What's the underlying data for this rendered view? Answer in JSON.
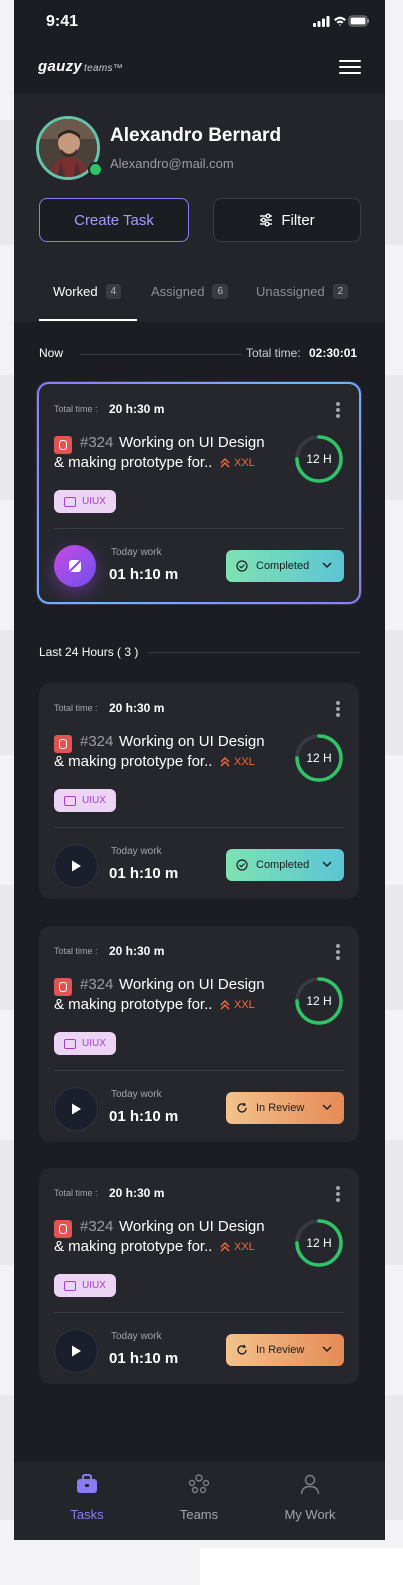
{
  "status_bar": {
    "time": "9:41"
  },
  "header": {
    "brand": "gauzy",
    "brand_suffix": "teams™"
  },
  "profile": {
    "name": "Alexandro Bernard",
    "email": "Alexandro@mail.com"
  },
  "actions": {
    "create_task": "Create Task",
    "filter": "Filter"
  },
  "tabs": [
    {
      "label": "Worked",
      "count": "4",
      "active": true
    },
    {
      "label": "Assigned",
      "count": "6",
      "active": false
    },
    {
      "label": "Unassigned",
      "count": "2",
      "active": false
    }
  ],
  "now_section": {
    "label": "Now",
    "total_label": "Total time:",
    "total_value": "02:30:01"
  },
  "last24_section": {
    "label": "Last 24 Hours ( 3 )"
  },
  "cards": [
    {
      "total_label": "Total time :",
      "total_value": "20 h:30 m",
      "task_number": "#324",
      "title_line1": "Working on UI Design",
      "title_line2": "& making prototype for..",
      "priority": "XXL",
      "estimate": "12 H",
      "progress": 0.75,
      "tag": "UIUX",
      "today_label": "Today work",
      "today_value": "01 h:10 m",
      "status": "Completed",
      "status_type": "completed"
    },
    {
      "total_label": "Total time :",
      "total_value": "20 h:30 m",
      "task_number": "#324",
      "title_line1": "Working on UI Design",
      "title_line2": "& making prototype for..",
      "priority": "XXL",
      "estimate": "12 H",
      "progress": 0.75,
      "tag": "UIUX",
      "today_label": "Today work",
      "today_value": "01 h:10 m",
      "status": "Completed",
      "status_type": "completed"
    },
    {
      "total_label": "Total time :",
      "total_value": "20 h:30 m",
      "task_number": "#324",
      "title_line1": "Working on UI Design",
      "title_line2": "& making prototype for..",
      "priority": "XXL",
      "estimate": "12 H",
      "progress": 0.75,
      "tag": "UIUX",
      "today_label": "Today work",
      "today_value": "01 h:10 m",
      "status": "In Review",
      "status_type": "review"
    },
    {
      "total_label": "Total time :",
      "total_value": "20 h:30 m",
      "task_number": "#324",
      "title_line1": "Working on UI Design",
      "title_line2": "& making prototype for..",
      "priority": "XXL",
      "estimate": "12 H",
      "progress": 0.75,
      "tag": "UIUX",
      "today_label": "Today work",
      "today_value": "01 h:10 m",
      "status": "In Review",
      "status_type": "review"
    }
  ],
  "bottom_nav": [
    {
      "label": "Tasks",
      "icon": "briefcase-icon",
      "active": true
    },
    {
      "label": "Teams",
      "icon": "teams-icon",
      "active": false
    },
    {
      "label": "My Work",
      "icon": "user-icon",
      "active": false
    }
  ],
  "colors": {
    "accent": "#8c7bf2",
    "progress_ring": "#2ec467",
    "priority": "#f26a3c",
    "completed": "#7ee2b2",
    "review": "#f3c28b"
  }
}
